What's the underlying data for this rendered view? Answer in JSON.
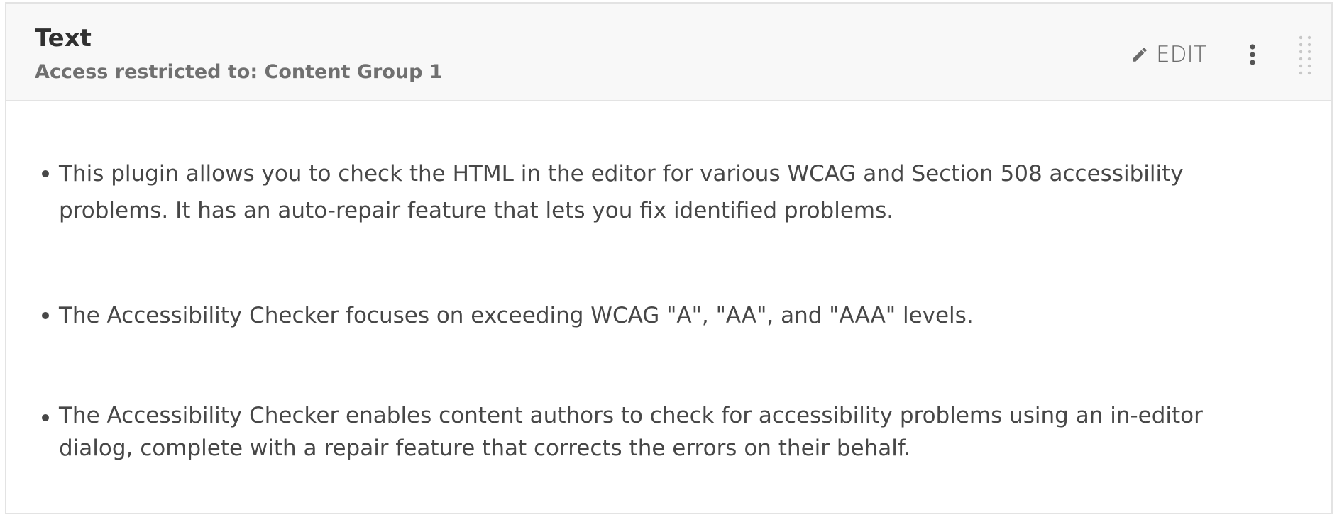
{
  "block": {
    "title": "Text",
    "subtitle": "Access restricted to: Content Group 1",
    "actions": {
      "edit_label": "EDIT",
      "edit_icon": "pencil-icon",
      "menu_icon": "vertical-ellipsis-icon",
      "drag_icon": "drag-handle-icon"
    },
    "items": [
      "This plugin allows you to check the HTML in the editor for various WCAG and Section 508 accessibility problems. It has an auto-repair feature that lets you fix identified problems.",
      "The Accessibility Checker focuses on exceeding WCAG \"A\", \"AA\", and \"AAA\" levels.",
      "The Accessibility Checker enables content authors to check for accessibility problems using an in-editor dialog, complete with a repair feature that corrects the errors on their behalf."
    ]
  },
  "colors": {
    "header_bg": "#f8f8f8",
    "border": "#e3e3e3",
    "title": "#313131",
    "subtitle": "#707070",
    "body_text": "#474747",
    "action_text": "#6b6b6b"
  }
}
